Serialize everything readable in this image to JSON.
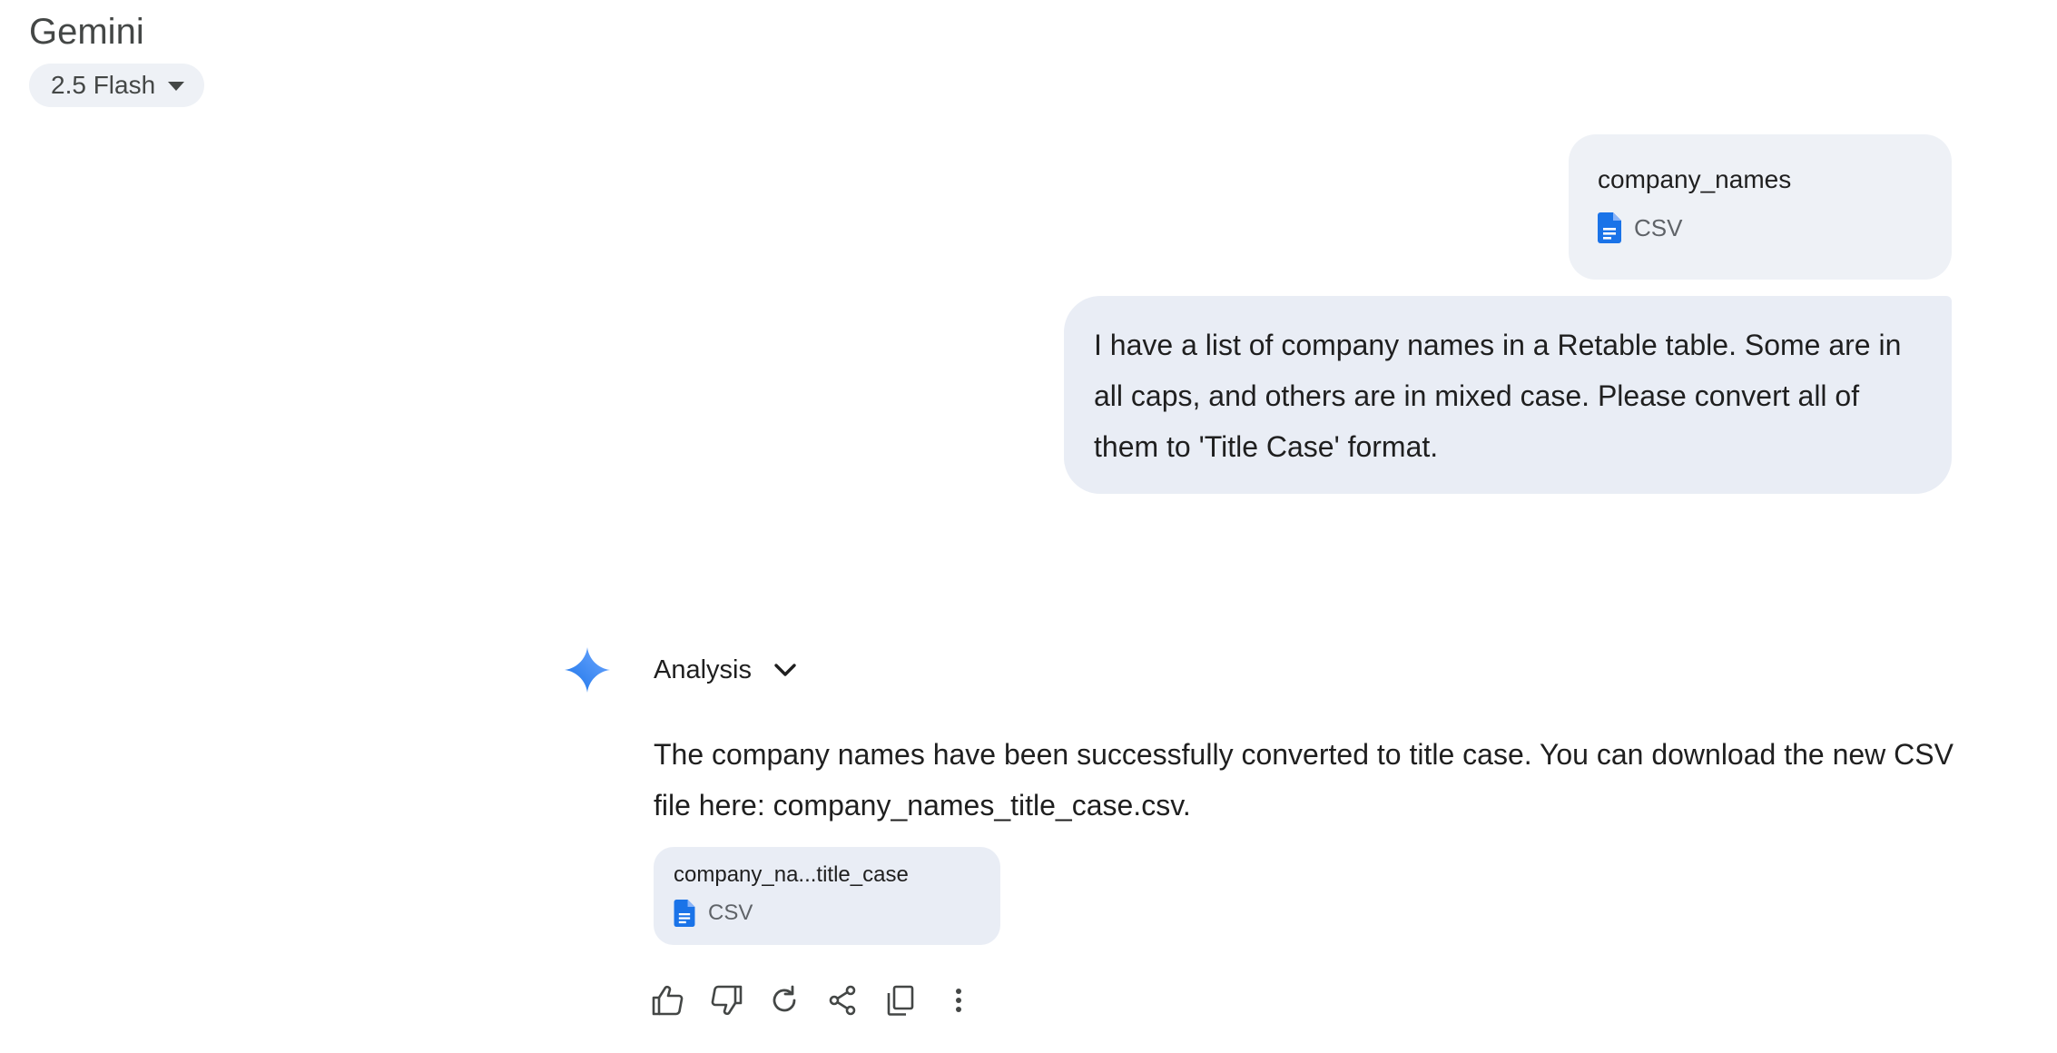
{
  "app": {
    "title": "Gemini",
    "model_label": "2.5 Flash"
  },
  "conversation": {
    "user_attachment": {
      "name": "company_names",
      "type": "CSV"
    },
    "user_message": "I have a list of company names in a Retable table. Some are in all caps, and others are in mixed case. Please convert all of them to 'Title Case' format.",
    "model": {
      "analysis_label": "Analysis",
      "response_text": "The company names have been successfully converted to title case. You can download the new CSV file here: company_names_title_case.csv.",
      "attachment": {
        "name": "company_na...title_case",
        "type": "CSV"
      },
      "actions": [
        "thumbs-up-icon",
        "thumbs-down-icon",
        "redo-icon",
        "share-icon",
        "copy-icon",
        "more-vert-icon"
      ]
    }
  },
  "colors": {
    "accent_blue": "#1a73e8",
    "bubble_bg": "#e9edf5",
    "chip_bg": "#eef1f6",
    "icon_gray": "#444746"
  }
}
